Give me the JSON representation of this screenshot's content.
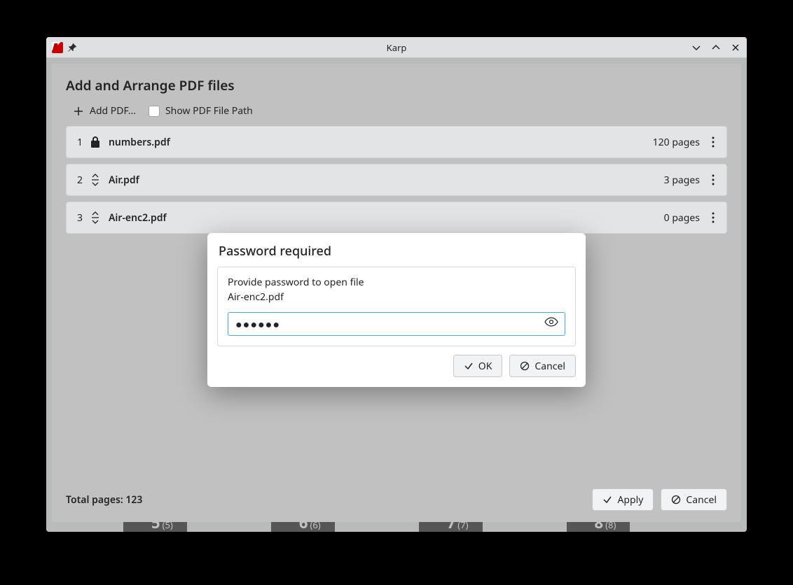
{
  "app_title": "Karp",
  "dialog1": {
    "title": "Add and Arrange PDF files",
    "add_pdf_label": "Add PDF…",
    "show_path_label": "Show PDF File Path",
    "files": [
      {
        "idx": "1",
        "name": "numbers.pdf",
        "pages": "120 pages",
        "icon": "lock"
      },
      {
        "idx": "2",
        "name": "Air.pdf",
        "pages": "3 pages",
        "icon": "drag"
      },
      {
        "idx": "3",
        "name": "Air-enc2.pdf",
        "pages": "0 pages",
        "icon": "drag"
      }
    ],
    "total_label": "Total pages: 123",
    "apply_label": "Apply",
    "cancel_label": "Cancel"
  },
  "dialog2": {
    "title": "Password required",
    "message": "Provide password to open file",
    "filename": "Air-enc2.pdf",
    "password_value": "●●●●●●",
    "ok_label": "OK",
    "cancel_label": "Cancel"
  },
  "page_thumbs": [
    {
      "n": "5",
      "s": "(5)"
    },
    {
      "n": "6",
      "s": "(6)"
    },
    {
      "n": "7",
      "s": "(7)"
    },
    {
      "n": "8",
      "s": "(8)"
    }
  ]
}
